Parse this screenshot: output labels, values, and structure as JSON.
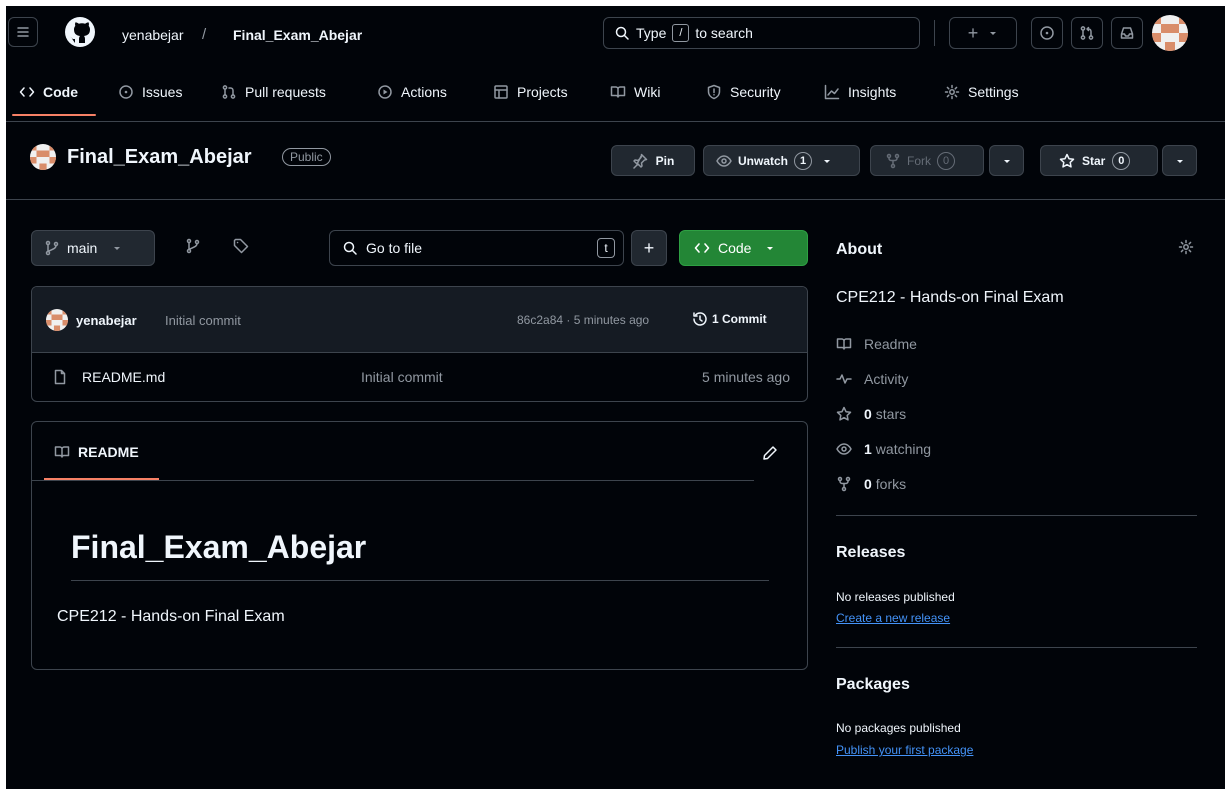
{
  "header": {
    "owner": "yenabejar",
    "separator": "/",
    "repo": "Final_Exam_Abejar",
    "search": {
      "prefix": "Type",
      "key": "/",
      "suffix": "to search"
    },
    "plus_label": "+"
  },
  "tabs": [
    {
      "label": "Code",
      "icon": "code-icon"
    },
    {
      "label": "Issues",
      "icon": "issue-icon"
    },
    {
      "label": "Pull requests",
      "icon": "pull-request-icon"
    },
    {
      "label": "Actions",
      "icon": "play-icon"
    },
    {
      "label": "Projects",
      "icon": "table-icon"
    },
    {
      "label": "Wiki",
      "icon": "book-icon"
    },
    {
      "label": "Security",
      "icon": "shield-icon"
    },
    {
      "label": "Insights",
      "icon": "graph-icon"
    },
    {
      "label": "Settings",
      "icon": "gear-icon"
    }
  ],
  "repo_header": {
    "name": "Final_Exam_Abejar",
    "visibility": "Public",
    "pin_label": "Pin",
    "unwatch_label": "Unwatch",
    "watch_count": "1",
    "fork_label": "Fork",
    "fork_count": "0",
    "star_label": "Star",
    "star_count": "0"
  },
  "file_nav": {
    "branch": "main",
    "go_to_file_placeholder": "Go to file",
    "shortcut_key": "t",
    "add_label": "+",
    "code_label": "Code"
  },
  "commit": {
    "author": "yenabejar",
    "message": "Initial commit",
    "meta": "86c2a84 · 5 minutes ago",
    "commits_label": "1 Commit"
  },
  "files": [
    {
      "name": "README.md",
      "message": "Initial commit",
      "time": "5 minutes ago"
    }
  ],
  "readme": {
    "tab_label": "README",
    "heading": "Final_Exam_Abejar",
    "body": "CPE212 - Hands-on Final Exam"
  },
  "about": {
    "title": "About",
    "description": "CPE212 - Hands-on Final Exam",
    "readme_label": "Readme",
    "activity_label": "Activity",
    "stars_count": "0",
    "stars_label": "stars",
    "watching_count": "1",
    "watching_label": "watching",
    "forks_count": "0",
    "forks_label": "forks"
  },
  "releases": {
    "title": "Releases",
    "empty_text": "No releases published",
    "link": "Create a new release"
  },
  "packages": {
    "title": "Packages",
    "empty_text": "No packages published",
    "link": "Publish your first package"
  },
  "colors": {
    "background": "#010409",
    "surface": "#0d1117",
    "border": "#3d444d",
    "accent_green": "#238636",
    "link_blue": "#4493f8",
    "tab_underline": "#f78166"
  }
}
